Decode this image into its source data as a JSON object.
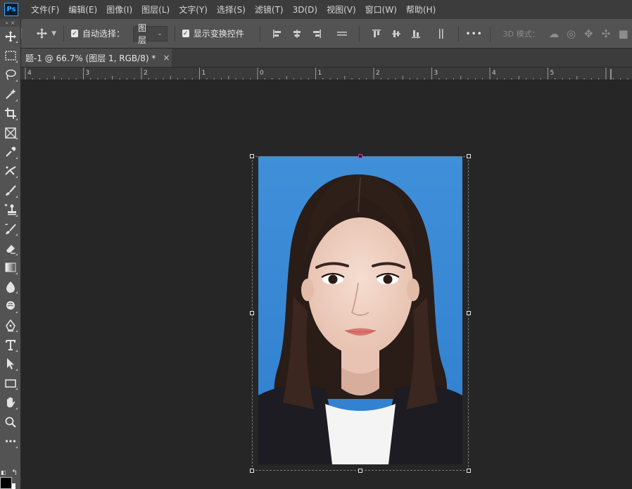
{
  "app": {
    "logo_text": "Ps"
  },
  "menu": [
    "文件(F)",
    "编辑(E)",
    "图像(I)",
    "图层(L)",
    "文字(Y)",
    "选择(S)",
    "滤镜(T)",
    "3D(D)",
    "视图(V)",
    "窗口(W)",
    "帮助(H)"
  ],
  "options": {
    "auto_select_label": "自动选择：",
    "auto_select_checked": true,
    "auto_select_target": "图层",
    "show_transform_label": "显示变换控件",
    "show_transform_checked": true,
    "more_label": "•••",
    "mode_3d_label": "3D 模式："
  },
  "document": {
    "tab_title": "题-1 @ 66.7% (图层 1, RGB/8) *",
    "close_glyph": "×"
  },
  "ruler": {
    "labels": [
      "4",
      "3",
      "2",
      "1",
      "0",
      "1",
      "2",
      "3",
      "4",
      "5"
    ]
  },
  "toolbar": {
    "collapse_glyph": "« ×",
    "tools": [
      "move-tool",
      "rectangular-marquee-tool",
      "lasso-tool",
      "magic-wand-tool",
      "crop-tool",
      "frame-tool",
      "eyedropper-tool",
      "spot-healing-tool",
      "brush-tool",
      "clone-stamp-tool",
      "history-brush-tool",
      "eraser-tool",
      "gradient-tool",
      "blur-tool",
      "dodge-tool",
      "pen-tool",
      "type-tool",
      "path-selection-tool",
      "rectangle-tool",
      "hand-tool",
      "zoom-tool",
      "edit-toolbar"
    ],
    "foreground_color": "#000000",
    "background_color": "#ffffff"
  },
  "colors": {
    "canvas_bg": "#262626",
    "photo_bg": "#3a8bd6",
    "panel": "#535353",
    "menubar": "#3c3c3c"
  }
}
